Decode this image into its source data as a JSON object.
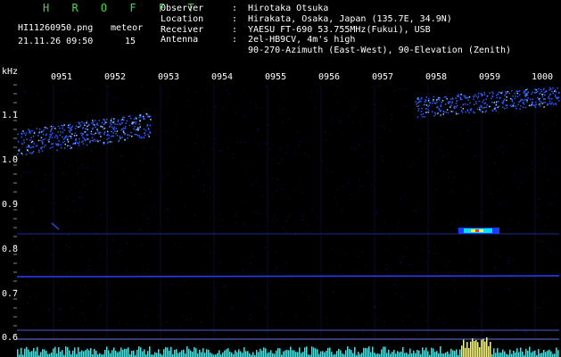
{
  "header": {
    "brand": "H R O F F T",
    "filename": "HI11260950.png",
    "datetime": "21.11.26 09:50",
    "meteor_label": "meteor",
    "meteor_count": "15"
  },
  "info": [
    {
      "key": "Observer",
      "value": "Hirotaka Otsuka"
    },
    {
      "key": "Location",
      "value": "Hirakata, Osaka, Japan (135.7E, 34.9N)"
    },
    {
      "key": "Receiver",
      "value": "YAESU FT-690 53.755MHz(Fukui), USB"
    },
    {
      "key": "Antenna",
      "value": "2el-HB9CV, 4m's high"
    },
    {
      "key": "",
      "value": "90-270-Azimuth (East-West), 90-Elevation (Zenith)"
    }
  ],
  "axis": {
    "y_unit": "kHz",
    "y_ticks": [
      "1.1",
      "1.0",
      "0.9",
      "0.8",
      "0.7",
      "0.6"
    ],
    "x_ticks": [
      "0951",
      "0952",
      "0953",
      "0954",
      "0955",
      "0956",
      "0957",
      "0958",
      "0959",
      "1000"
    ]
  },
  "colors": {
    "background": "#000000",
    "brand": "#3fdc3f",
    "text": "#ffffff",
    "signal": "#2e5cff",
    "line": "#2a3cff",
    "hot": "#ffff40",
    "bars": "#00ffff"
  }
}
